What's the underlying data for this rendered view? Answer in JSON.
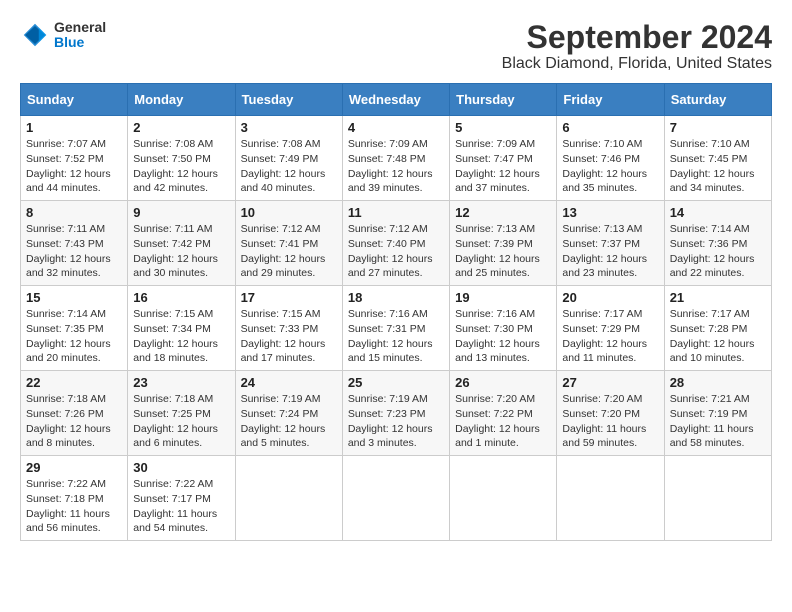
{
  "header": {
    "logo_line1": "General",
    "logo_line2": "Blue",
    "title": "September 2024",
    "subtitle": "Black Diamond, Florida, United States"
  },
  "weekdays": [
    "Sunday",
    "Monday",
    "Tuesday",
    "Wednesday",
    "Thursday",
    "Friday",
    "Saturday"
  ],
  "weeks": [
    [
      {
        "day": "1",
        "info": "Sunrise: 7:07 AM\nSunset: 7:52 PM\nDaylight: 12 hours\nand 44 minutes."
      },
      {
        "day": "2",
        "info": "Sunrise: 7:08 AM\nSunset: 7:50 PM\nDaylight: 12 hours\nand 42 minutes."
      },
      {
        "day": "3",
        "info": "Sunrise: 7:08 AM\nSunset: 7:49 PM\nDaylight: 12 hours\nand 40 minutes."
      },
      {
        "day": "4",
        "info": "Sunrise: 7:09 AM\nSunset: 7:48 PM\nDaylight: 12 hours\nand 39 minutes."
      },
      {
        "day": "5",
        "info": "Sunrise: 7:09 AM\nSunset: 7:47 PM\nDaylight: 12 hours\nand 37 minutes."
      },
      {
        "day": "6",
        "info": "Sunrise: 7:10 AM\nSunset: 7:46 PM\nDaylight: 12 hours\nand 35 minutes."
      },
      {
        "day": "7",
        "info": "Sunrise: 7:10 AM\nSunset: 7:45 PM\nDaylight: 12 hours\nand 34 minutes."
      }
    ],
    [
      {
        "day": "8",
        "info": "Sunrise: 7:11 AM\nSunset: 7:43 PM\nDaylight: 12 hours\nand 32 minutes."
      },
      {
        "day": "9",
        "info": "Sunrise: 7:11 AM\nSunset: 7:42 PM\nDaylight: 12 hours\nand 30 minutes."
      },
      {
        "day": "10",
        "info": "Sunrise: 7:12 AM\nSunset: 7:41 PM\nDaylight: 12 hours\nand 29 minutes."
      },
      {
        "day": "11",
        "info": "Sunrise: 7:12 AM\nSunset: 7:40 PM\nDaylight: 12 hours\nand 27 minutes."
      },
      {
        "day": "12",
        "info": "Sunrise: 7:13 AM\nSunset: 7:39 PM\nDaylight: 12 hours\nand 25 minutes."
      },
      {
        "day": "13",
        "info": "Sunrise: 7:13 AM\nSunset: 7:37 PM\nDaylight: 12 hours\nand 23 minutes."
      },
      {
        "day": "14",
        "info": "Sunrise: 7:14 AM\nSunset: 7:36 PM\nDaylight: 12 hours\nand 22 minutes."
      }
    ],
    [
      {
        "day": "15",
        "info": "Sunrise: 7:14 AM\nSunset: 7:35 PM\nDaylight: 12 hours\nand 20 minutes."
      },
      {
        "day": "16",
        "info": "Sunrise: 7:15 AM\nSunset: 7:34 PM\nDaylight: 12 hours\nand 18 minutes."
      },
      {
        "day": "17",
        "info": "Sunrise: 7:15 AM\nSunset: 7:33 PM\nDaylight: 12 hours\nand 17 minutes."
      },
      {
        "day": "18",
        "info": "Sunrise: 7:16 AM\nSunset: 7:31 PM\nDaylight: 12 hours\nand 15 minutes."
      },
      {
        "day": "19",
        "info": "Sunrise: 7:16 AM\nSunset: 7:30 PM\nDaylight: 12 hours\nand 13 minutes."
      },
      {
        "day": "20",
        "info": "Sunrise: 7:17 AM\nSunset: 7:29 PM\nDaylight: 12 hours\nand 11 minutes."
      },
      {
        "day": "21",
        "info": "Sunrise: 7:17 AM\nSunset: 7:28 PM\nDaylight: 12 hours\nand 10 minutes."
      }
    ],
    [
      {
        "day": "22",
        "info": "Sunrise: 7:18 AM\nSunset: 7:26 PM\nDaylight: 12 hours\nand 8 minutes."
      },
      {
        "day": "23",
        "info": "Sunrise: 7:18 AM\nSunset: 7:25 PM\nDaylight: 12 hours\nand 6 minutes."
      },
      {
        "day": "24",
        "info": "Sunrise: 7:19 AM\nSunset: 7:24 PM\nDaylight: 12 hours\nand 5 minutes."
      },
      {
        "day": "25",
        "info": "Sunrise: 7:19 AM\nSunset: 7:23 PM\nDaylight: 12 hours\nand 3 minutes."
      },
      {
        "day": "26",
        "info": "Sunrise: 7:20 AM\nSunset: 7:22 PM\nDaylight: 12 hours\nand 1 minute."
      },
      {
        "day": "27",
        "info": "Sunrise: 7:20 AM\nSunset: 7:20 PM\nDaylight: 11 hours\nand 59 minutes."
      },
      {
        "day": "28",
        "info": "Sunrise: 7:21 AM\nSunset: 7:19 PM\nDaylight: 11 hours\nand 58 minutes."
      }
    ],
    [
      {
        "day": "29",
        "info": "Sunrise: 7:22 AM\nSunset: 7:18 PM\nDaylight: 11 hours\nand 56 minutes."
      },
      {
        "day": "30",
        "info": "Sunrise: 7:22 AM\nSunset: 7:17 PM\nDaylight: 11 hours\nand 54 minutes."
      },
      null,
      null,
      null,
      null,
      null
    ]
  ]
}
